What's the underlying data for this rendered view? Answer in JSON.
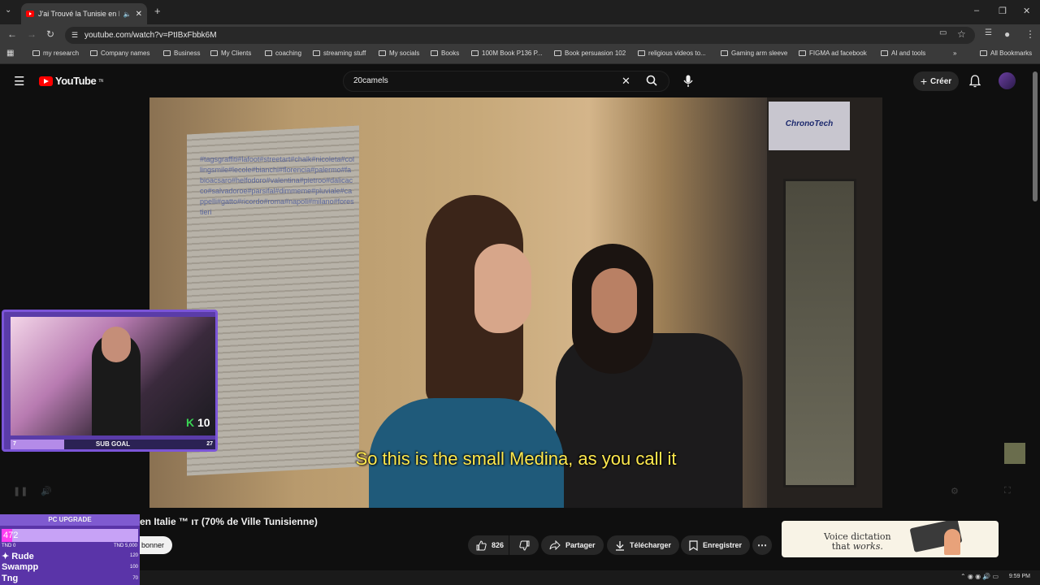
{
  "browser": {
    "tab_title": "J'ai Trouvé la Tunisie en Itali",
    "url": "youtube.com/watch?v=PtIBxFbbk6M",
    "bookmarks": [
      "my research",
      "Company names",
      "Business",
      "My Clients",
      "coaching",
      "streaming stuff",
      "My socials",
      "Books",
      "100M Book P136 P...",
      "Book persuasion 102",
      "religious videos to...",
      "Gaming arm sleeve",
      "FIGMA ad facebook",
      "AI and tools"
    ],
    "all_bookmarks": "All Bookmarks"
  },
  "youtube": {
    "logo_text": "YouTube",
    "logo_sup": "TN",
    "search_value": "20camels",
    "create_label": "Créer"
  },
  "video": {
    "subtitle": "So this is the small Medina, as you call it",
    "shop_sign": "ChronoTech",
    "title": "en Italie ™ ıт (70% de Ville Tunisienne)",
    "subscribe_label": "bonner"
  },
  "actions": {
    "likes": "826",
    "share": "Partager",
    "download": "Télécharger",
    "save": "Enregistrer"
  },
  "ad": {
    "line1": "Voice dictation",
    "line2_prefix": "that ",
    "line2_em": "works."
  },
  "webcam": {
    "k_value": "10",
    "goal_label": "SUB GOAL",
    "goal_current": "7",
    "goal_target": "27",
    "goal_fraction": 0.26
  },
  "pc_upgrade": {
    "title": "PC UPGRADE",
    "value": "472",
    "min": "TND 0",
    "max": "TND 5,000",
    "fraction": 0.08,
    "leaders": [
      {
        "name": "Rude",
        "amount": "120"
      },
      {
        "name": "Swampp",
        "amount": "100"
      },
      {
        "name": "Tng",
        "amount": "70"
      }
    ]
  },
  "taskbar": {
    "time": "9:59 PM"
  }
}
